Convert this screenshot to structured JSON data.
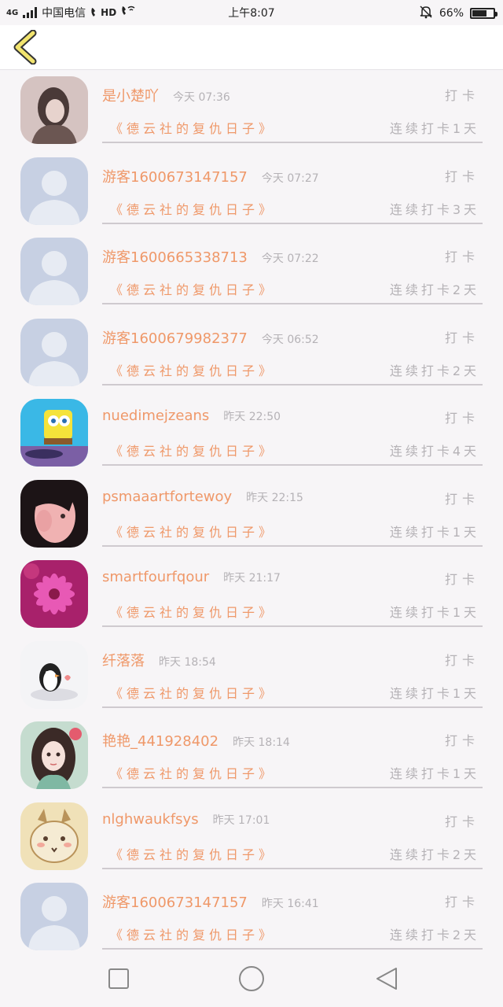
{
  "status_bar": {
    "network": "4G",
    "carrier": "中国电信",
    "hd": "HD",
    "time": "上午8:07",
    "battery_text": "66%",
    "battery_level": 0.66
  },
  "list": [
    {
      "avatar": "photo-girl",
      "name": "是小楚吖",
      "time": "今天 07:36",
      "action": "打卡",
      "book": "《德云社的复仇日子》",
      "streak": "连续打卡1天"
    },
    {
      "avatar": "default-person",
      "name": "游客1600673147157",
      "time": "今天 07:27",
      "action": "打卡",
      "book": "《德云社的复仇日子》",
      "streak": "连续打卡3天"
    },
    {
      "avatar": "default-person",
      "name": "游客1600665338713",
      "time": "今天 07:22",
      "action": "打卡",
      "book": "《德云社的复仇日子》",
      "streak": "连续打卡2天"
    },
    {
      "avatar": "default-person",
      "name": "游客1600679982377",
      "time": "今天 06:52",
      "action": "打卡",
      "book": "《德云社的复仇日子》",
      "streak": "连续打卡2天"
    },
    {
      "avatar": "spongebob",
      "name": "nuedimejzeans",
      "time": "昨天 22:50",
      "action": "打卡",
      "book": "《德云社的复仇日子》",
      "streak": "连续打卡4天"
    },
    {
      "avatar": "photo-woman",
      "name": "psmaaartfortewoy",
      "time": "昨天 22:15",
      "action": "打卡",
      "book": "《德云社的复仇日子》",
      "streak": "连续打卡1天"
    },
    {
      "avatar": "pink-flower",
      "name": "smartfourfqour",
      "time": "昨天 21:17",
      "action": "打卡",
      "book": "《德云社的复仇日子》",
      "streak": "连续打卡1天"
    },
    {
      "avatar": "penguin",
      "name": "纤落落",
      "time": "昨天 18:54",
      "action": "打卡",
      "book": "《德云社的复仇日子》",
      "streak": "连续打卡1天"
    },
    {
      "avatar": "anime-girl",
      "name": "艳艳_441928402",
      "time": "昨天 18:14",
      "action": "打卡",
      "book": "《德云社的复仇日子》",
      "streak": "连续打卡1天"
    },
    {
      "avatar": "cartoon-goat",
      "name": "nlghwaukfsys",
      "time": "昨天 17:01",
      "action": "打卡",
      "book": "《德云社的复仇日子》",
      "streak": "连续打卡2天"
    },
    {
      "avatar": "default-person",
      "name": "游客1600673147157",
      "time": "昨天 16:41",
      "action": "打卡",
      "book": "《德云社的复仇日子》",
      "streak": "连续打卡2天"
    }
  ],
  "colors": {
    "accent_orange": "#ef9869",
    "muted_gray": "#b5b2b6",
    "back_arrow_yellow": "#f2e46e",
    "background": "#f7f5f7"
  },
  "nav_icons": [
    "square-icon",
    "circle-icon",
    "triangle-back-icon"
  ]
}
